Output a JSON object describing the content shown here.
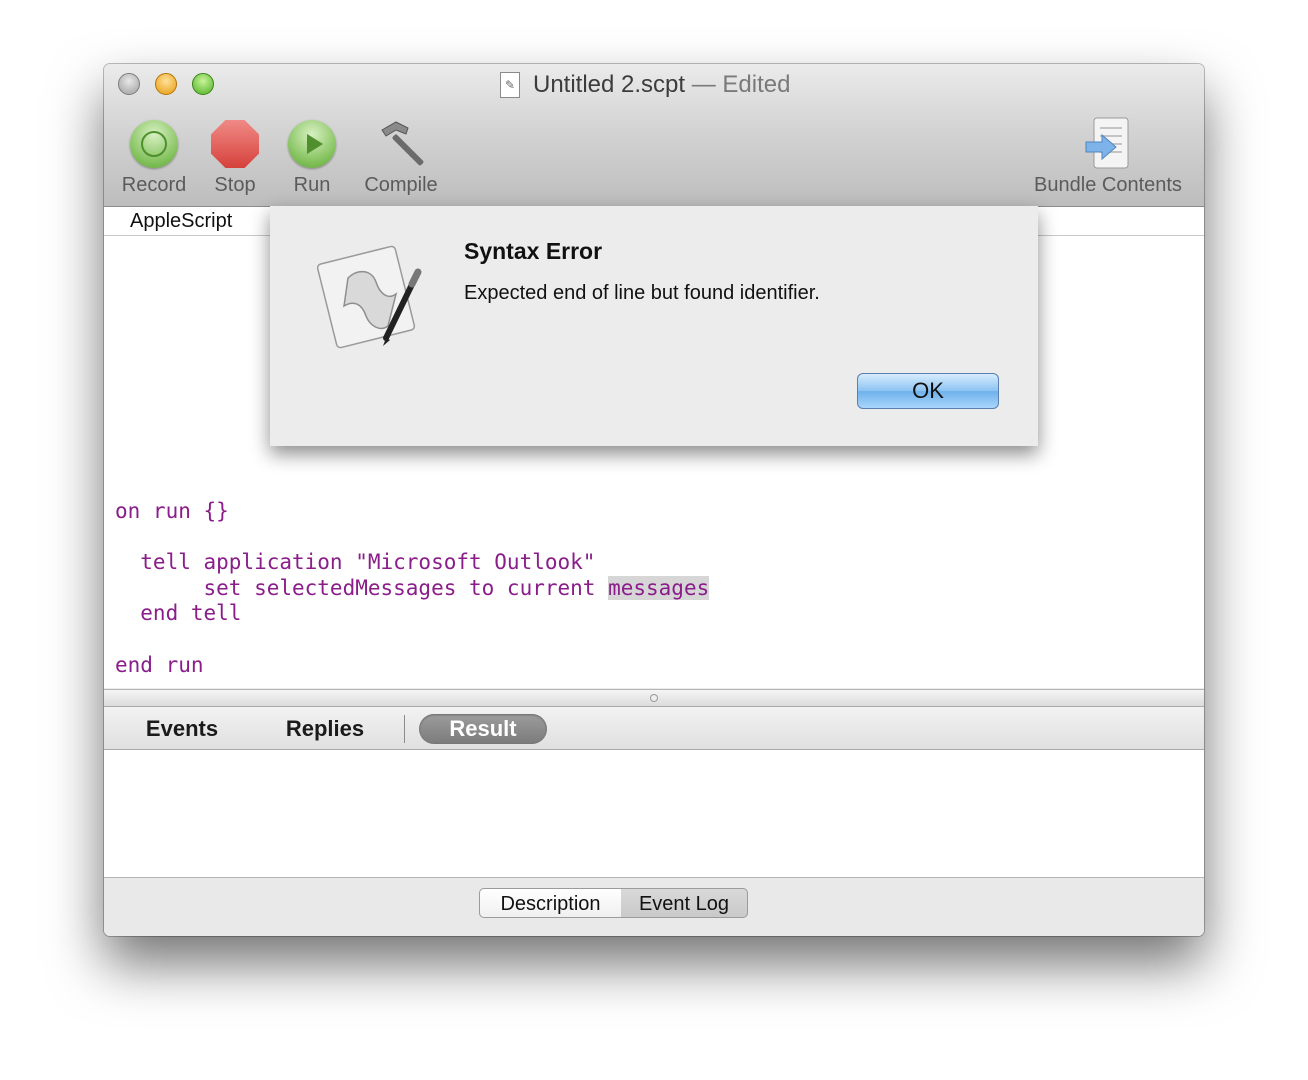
{
  "window": {
    "title": "Untitled 2.scpt",
    "edited_suffix": "— Edited"
  },
  "toolbar": {
    "record_label": "Record",
    "stop_label": "Stop",
    "run_label": "Run",
    "compile_label": "Compile",
    "bundle_label": "Bundle Contents",
    "icons": [
      "record-icon",
      "stop-icon",
      "run-icon",
      "hammer-icon",
      "bundle-contents-icon"
    ]
  },
  "navigation_bar": {
    "language": "AppleScript"
  },
  "editor": {
    "lines": [
      "on run {}",
      "",
      "  tell application \"Microsoft Outlook\"",
      "       set selectedMessages to current ",
      "  end tell",
      "",
      "end run"
    ],
    "highlighted_word": "messages",
    "text_color": "#8a1d8a"
  },
  "log_tabs": {
    "events": "Events",
    "replies": "Replies",
    "result": "Result",
    "selected": "Result"
  },
  "bottom_bar": {
    "description": "Description",
    "event_log": "Event Log"
  },
  "alert": {
    "title": "Syntax Error",
    "message": "Expected end of line but found identifier.",
    "ok_label": "OK",
    "icon": "script-editor-icon"
  }
}
